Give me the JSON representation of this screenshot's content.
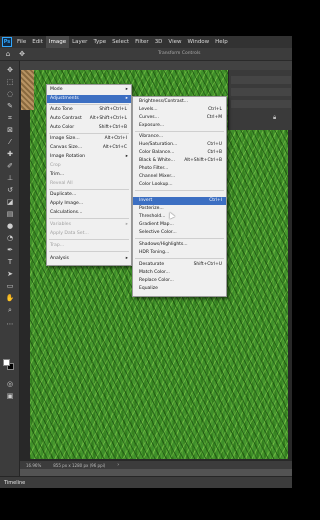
{
  "app": {
    "logo": "Ps",
    "menu": [
      "File",
      "Edit",
      "Image",
      "Layer",
      "Type",
      "Select",
      "Filter",
      "3D",
      "View",
      "Window",
      "Help"
    ],
    "active_menu": "Image",
    "options_label": "Transform Controls"
  },
  "image_menu": [
    {
      "label": "Mode",
      "arrow": "▸"
    },
    {
      "label": "Adjustments",
      "arrow": "▸",
      "highlight": true
    },
    {
      "label": "Auto Tone",
      "shortcut": "Shift+Ctrl+L"
    },
    {
      "label": "Auto Contrast",
      "shortcut": "Alt+Shift+Ctrl+L"
    },
    {
      "label": "Auto Color",
      "shortcut": "Shift+Ctrl+B"
    },
    {
      "label": "Image Size...",
      "shortcut": "Alt+Ctrl+I"
    },
    {
      "label": "Canvas Size...",
      "shortcut": "Alt+Ctrl+C"
    },
    {
      "label": "Image Rotation",
      "arrow": "▸"
    },
    {
      "label": "Crop",
      "disabled": true
    },
    {
      "label": "Trim..."
    },
    {
      "label": "Reveal All",
      "disabled": true
    },
    {
      "label": "Duplicate..."
    },
    {
      "label": "Apply Image..."
    },
    {
      "label": "Calculations..."
    },
    {
      "label": "Variables",
      "arrow": "▸",
      "disabled": true
    },
    {
      "label": "Apply Data Set...",
      "disabled": true
    },
    {
      "label": "Trap...",
      "disabled": true
    },
    {
      "label": "Analysis",
      "arrow": "▸"
    }
  ],
  "adjustments_menu": [
    {
      "label": "Brightness/Contrast..."
    },
    {
      "label": "Levels...",
      "shortcut": "Ctrl+L"
    },
    {
      "label": "Curves...",
      "shortcut": "Ctrl+M"
    },
    {
      "label": "Exposure..."
    },
    {
      "label": "Vibrance..."
    },
    {
      "label": "Hue/Saturation...",
      "shortcut": "Ctrl+U"
    },
    {
      "label": "Color Balance...",
      "shortcut": "Ctrl+B"
    },
    {
      "label": "Black & White...",
      "shortcut": "Alt+Shift+Ctrl+B"
    },
    {
      "label": "Photo Filter..."
    },
    {
      "label": "Channel Mixer..."
    },
    {
      "label": "Color Lookup..."
    },
    {
      "label": "Invert",
      "shortcut": "Ctrl+I",
      "highlight": true
    },
    {
      "label": "Posterize..."
    },
    {
      "label": "Threshold..."
    },
    {
      "label": "Gradient Map..."
    },
    {
      "label": "Selective Color..."
    },
    {
      "label": "Shadows/Highlights..."
    },
    {
      "label": "HDR Toning..."
    },
    {
      "label": "Desaturate",
      "shortcut": "Shift+Ctrl+U"
    },
    {
      "label": "Match Color..."
    },
    {
      "label": "Replace Color..."
    },
    {
      "label": "Equalize"
    }
  ],
  "status": {
    "zoom": "16.96%",
    "doc_info": "855 px x 1280 px (96 ppi)"
  },
  "timeline_label": "Timeline",
  "colors": {
    "highlight": "#3c6fc2",
    "menu_bg": "#f0f0f0",
    "app_bg": "#535353"
  }
}
